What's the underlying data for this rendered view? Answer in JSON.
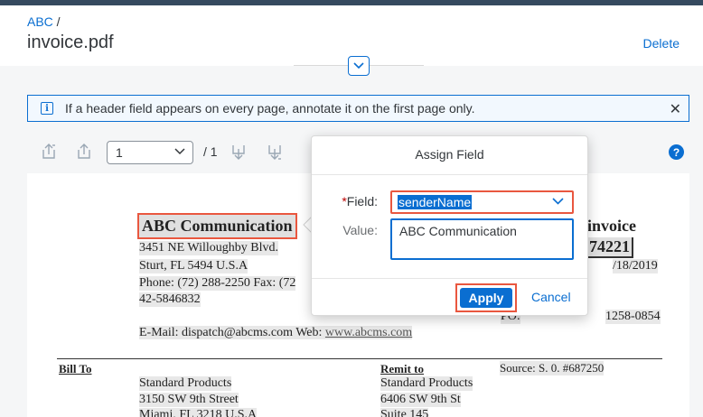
{
  "breadcrumb": {
    "parent": "ABC",
    "separator": " /"
  },
  "header": {
    "title": "invoice.pdf",
    "delete_label": "Delete"
  },
  "info_strip": {
    "message": "If a header field appears on every page, annotate it on the first page only."
  },
  "toolbar": {
    "page_value": "1",
    "page_total": "/ 1"
  },
  "document": {
    "company": "ABC Communication",
    "address1": "3451 NE Willoughby Blvd.",
    "address2": "Sturt, FL 5494 U.S.A",
    "phone": "Phone: (72) 288-2250   Fax: (72",
    "phone_cont": "42-5846832",
    "email_web_prefix": "E-Mail: dispatch@abcms.com Web: ",
    "web": "www.abcms.com",
    "invoice_word": "invoice",
    "invoice_number": "74221",
    "date": "/18/2019",
    "po_label": "PO:",
    "po_value": "1258-0854",
    "bill_to": "Bill To",
    "bill_to_lines": [
      "Standard Products",
      "3150 SW 9th Street",
      "Miami, FL 3218 U.S.A"
    ],
    "remit_to": "Remit to",
    "remit_to_lines": [
      "Standard Products",
      "6406 SW 9th St",
      "Suite 145"
    ],
    "source": "Source: S. 0. #687250"
  },
  "dialog": {
    "title": "Assign Field",
    "field_required_mark": "*",
    "field_label": "Field:",
    "field_value": "senderName",
    "value_label": "Value:",
    "value_text": "ABC Communication",
    "apply_label": "Apply",
    "cancel_label": "Cancel"
  },
  "colors": {
    "accent": "#0a6ed1",
    "highlight_border": "#e9573f",
    "shell": "#354a5f"
  }
}
